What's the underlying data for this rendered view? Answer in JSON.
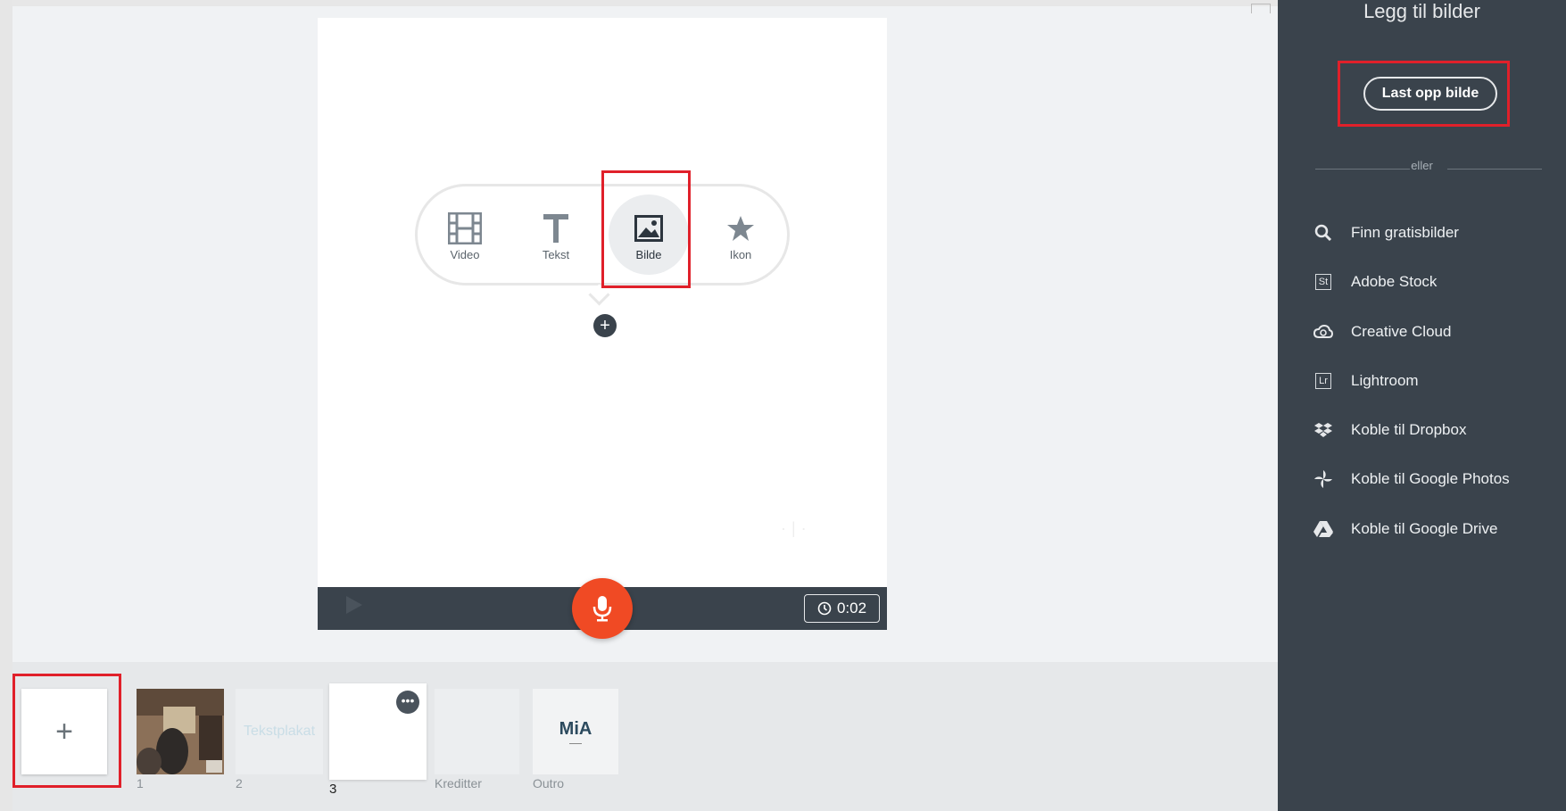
{
  "panel": {
    "title": "Legg til bilder",
    "upload_label": "Last opp bilde",
    "divider_label": "eller",
    "sources": [
      {
        "label": "Finn gratisbilder",
        "icon": "search-icon"
      },
      {
        "label": "Adobe Stock",
        "icon": "adobe-stock-icon",
        "badge": "St"
      },
      {
        "label": "Creative Cloud",
        "icon": "creative-cloud-icon"
      },
      {
        "label": "Lightroom",
        "icon": "lightroom-icon",
        "badge": "Lr"
      },
      {
        "label": "Koble til Dropbox",
        "icon": "dropbox-icon"
      },
      {
        "label": "Koble til Google Photos",
        "icon": "google-photos-icon"
      },
      {
        "label": "Koble til Google Drive",
        "icon": "google-drive-icon"
      }
    ]
  },
  "content_menu": {
    "items": [
      {
        "label": "Video",
        "icon": "film-icon"
      },
      {
        "label": "Tekst",
        "icon": "text-icon"
      },
      {
        "label": "Bilde",
        "icon": "image-icon",
        "selected": true
      },
      {
        "label": "Ikon",
        "icon": "star-icon"
      }
    ]
  },
  "player": {
    "duration": "0:02"
  },
  "slides": [
    {
      "number": "1",
      "type": "photo"
    },
    {
      "number": "2",
      "text": "Tekstplakat"
    },
    {
      "number": "3",
      "active": true
    },
    {
      "number": "Kreditter"
    },
    {
      "number": "Outro",
      "logo": "MiA"
    }
  ],
  "colors": {
    "accent_red": "#f04a24",
    "panel_bg": "#3a434c",
    "highlight_box": "#e0202a"
  }
}
